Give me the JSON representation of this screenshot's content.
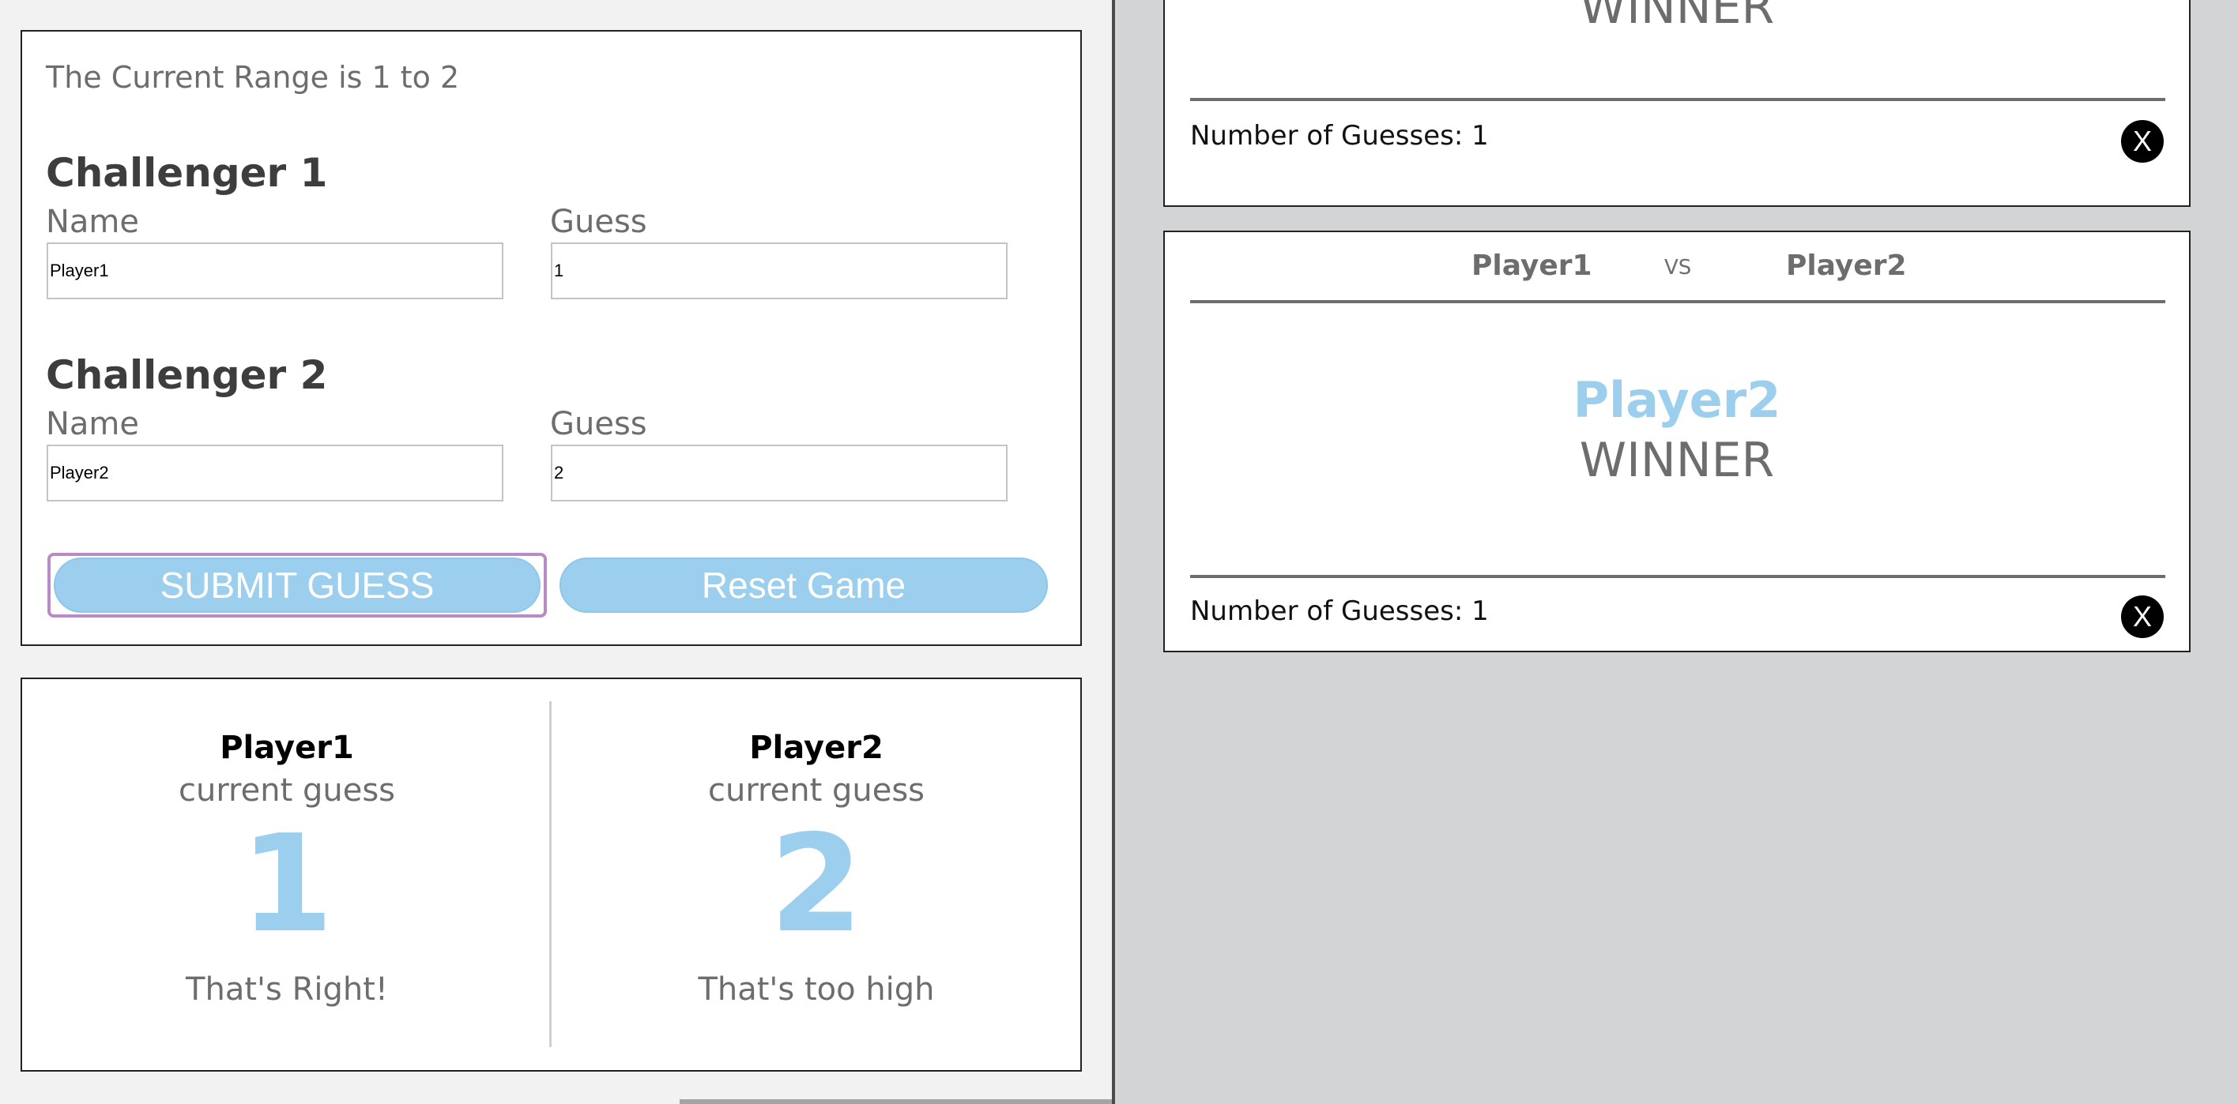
{
  "form": {
    "range_text": "The Current Range is 1 to 2",
    "challenger1": {
      "title": "Challenger 1",
      "name_label": "Name",
      "guess_label": "Guess",
      "name_value": "Player1",
      "guess_value": "1"
    },
    "challenger2": {
      "title": "Challenger 2",
      "name_label": "Name",
      "guess_label": "Guess",
      "name_value": "Player2",
      "guess_value": "2"
    },
    "submit_label": "SUBMIT GUESS",
    "reset_label": "Reset Game"
  },
  "scores": {
    "player1": {
      "name": "Player1",
      "sub": "current guess",
      "guess": "1",
      "message": "That's Right!"
    },
    "player2": {
      "name": "Player2",
      "sub": "current guess",
      "guess": "2",
      "message": "That's too high"
    }
  },
  "results": [
    {
      "winner_label": "WINNER",
      "guesses_text": "Number of Guesses: 1",
      "close_label": "X"
    },
    {
      "player_a": "Player1",
      "vs": "VS",
      "player_b": "Player2",
      "winner_name": "Player2",
      "winner_label": "WINNER",
      "guesses_text": "Number of Guesses: 1",
      "close_label": "X"
    }
  ],
  "colors": {
    "accent": "#9ccfee",
    "focus_ring": "#b88bc6",
    "right_pane_bg": "#d3d4d6"
  }
}
